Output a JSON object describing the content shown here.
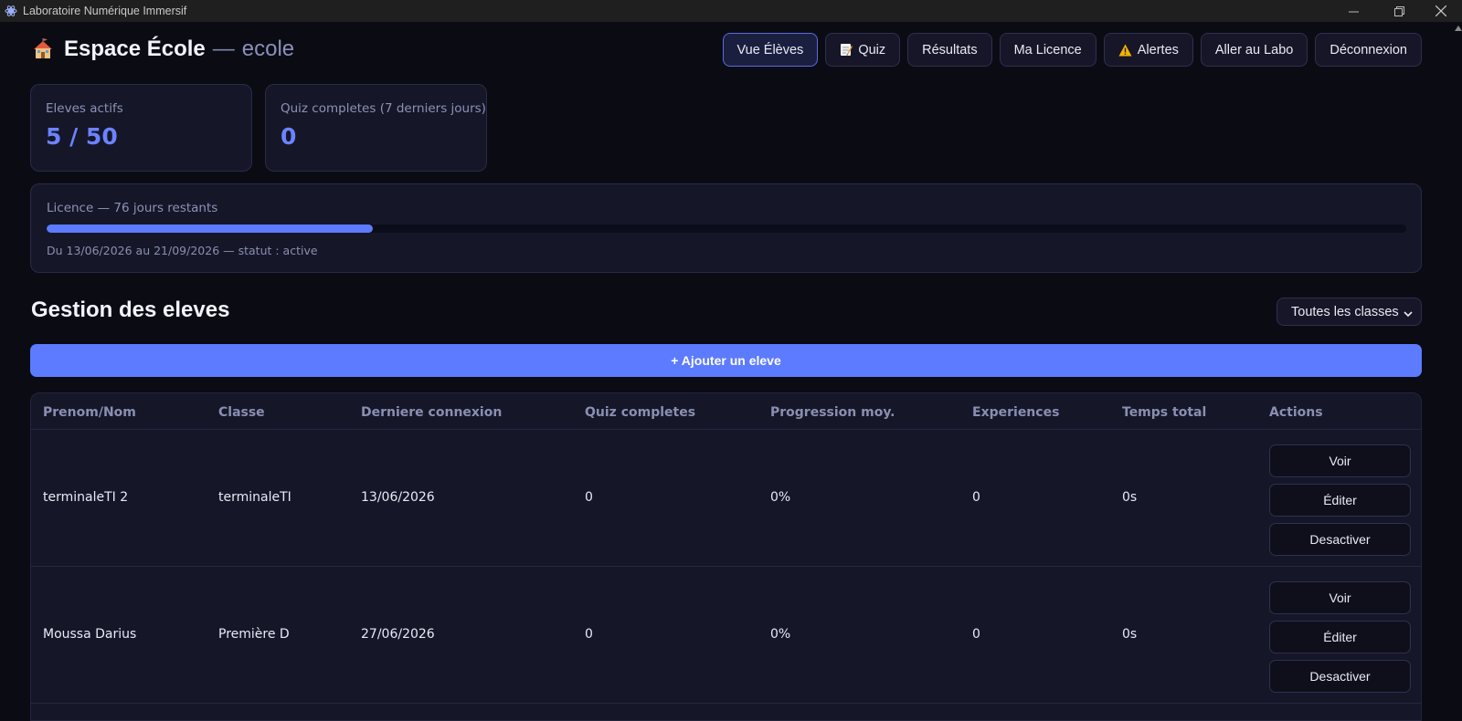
{
  "window": {
    "title": "Laboratoire Numérique Immersif"
  },
  "header": {
    "title": "Espace École",
    "separator": "—",
    "subtitle": "ecole"
  },
  "nav": {
    "eleves": "Vue Élèves",
    "quiz": "Quiz",
    "resultats": "Résultats",
    "licence": "Ma Licence",
    "alertes": "Alertes",
    "labo": "Aller au Labo",
    "logout": "Déconnexion"
  },
  "stats": {
    "active": {
      "label": "Eleves actifs",
      "value": "5 / 50"
    },
    "quiz": {
      "label": "Quiz completes (7 derniers jours)",
      "value": "0"
    }
  },
  "license": {
    "title": "Licence — 76 jours restants",
    "progress_fraction": 0.24,
    "dates": "Du 13/06/2026 au 21/09/2026 — statut : active"
  },
  "section": {
    "title": "Gestion des eleves",
    "class_filter": "Toutes les classes",
    "add_button": "+ Ajouter un eleve"
  },
  "table": {
    "headers": [
      "Prenom/Nom",
      "Classe",
      "Derniere connexion",
      "Quiz completes",
      "Progression moy.",
      "Experiences",
      "Temps total",
      "Actions"
    ],
    "rows": [
      {
        "name": "terminaleTI 2",
        "classe": "terminaleTI",
        "last": "13/06/2026",
        "quiz": "0",
        "progress": "0%",
        "experiences": "0",
        "time": "0s"
      },
      {
        "name": "Moussa Darius",
        "classe": "Première D",
        "last": "27/06/2026",
        "quiz": "0",
        "progress": "0%",
        "experiences": "0",
        "time": "0s"
      }
    ],
    "actions": {
      "view": "Voir",
      "edit": "Éditer",
      "deactivate": "Desactiver"
    }
  },
  "colors": {
    "accent": "#5c7bff",
    "background": "#0b0b14",
    "card": "#151628",
    "warning": "#f5b301"
  }
}
